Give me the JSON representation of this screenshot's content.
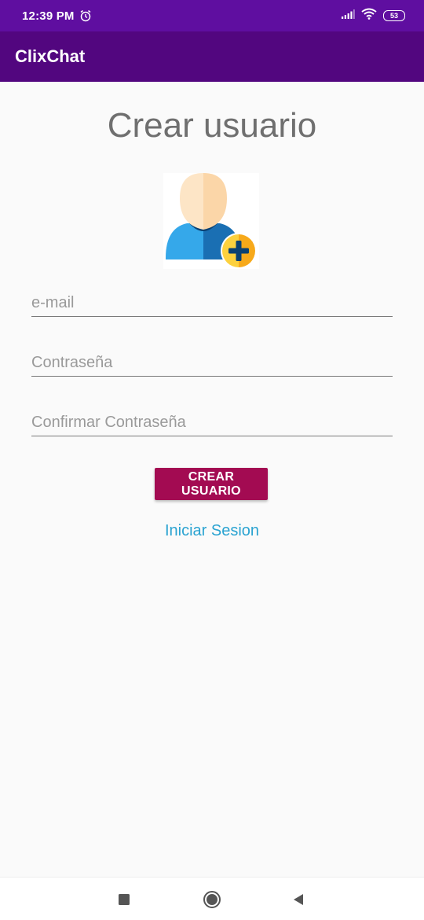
{
  "status_bar": {
    "time": "12:39 PM",
    "battery": "53",
    "icons": [
      "alarm-icon",
      "signal-icon",
      "wifi-icon",
      "battery-icon"
    ]
  },
  "app_bar": {
    "title": "ClixChat"
  },
  "form": {
    "title": "Crear usuario",
    "avatar_icon": "add-user-icon",
    "email_placeholder": "e-mail",
    "email_value": "",
    "password_placeholder": "Contraseña",
    "password_value": "",
    "confirm_placeholder": "Confirmar Contraseña",
    "confirm_value": "",
    "create_button": "CREAR USUARIO",
    "login_link": "Iniciar Sesion"
  },
  "nav_bar": {
    "icons": [
      "recent-apps-icon",
      "home-icon",
      "back-icon"
    ]
  },
  "colors": {
    "status_bar": "#5f0ea0",
    "app_bar": "#52067f",
    "button": "#a30b52",
    "link": "#2aa3d1",
    "title_text": "#6f6f6f"
  }
}
